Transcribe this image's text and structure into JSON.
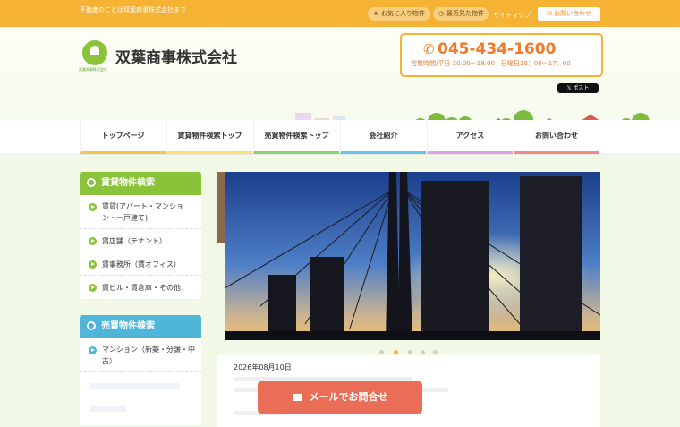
{
  "header": {
    "tagline": "不動産のことは双葉商事株式会社まで",
    "favorites": "お気に入り物件",
    "recent": "最近見た物件",
    "sitemap": "サイトマップ",
    "contact": "お問い合わせ",
    "company_name": "双葉商事株式会社",
    "logo_sub": "双葉商事株式会社",
    "phone": "045-434-1600",
    "hours": "営業時間/平日 10:00～18:00　日曜日10：00～17：00",
    "post": "ポスト"
  },
  "nav": [
    {
      "label": "トップページ",
      "color": "#f2c544"
    },
    {
      "label": "賃貸物件検索トップ",
      "color": "#f6e36a"
    },
    {
      "label": "売買物件検索トップ",
      "color": "#8fd16a"
    },
    {
      "label": "会社紹介",
      "color": "#65c7e6"
    },
    {
      "label": "アクセス",
      "color": "#d7a6e0"
    },
    {
      "label": "お問い合わせ",
      "color": "#f2897e"
    }
  ],
  "rental": {
    "title": "賃貸物件検索",
    "color": "#8ac23a",
    "items": [
      "賃貸(アパート・マンション・一戸建て)",
      "賃店舗（テナント）",
      "賃事務所（賃オフィス）",
      "賃ビル・賃倉庫・その他"
    ]
  },
  "sale": {
    "title": "売買物件検索",
    "color": "#4fb5da",
    "items": [
      "マンション（新築・分譲・中古）"
    ]
  },
  "news": {
    "date": "2026年08月10日"
  },
  "mail_button": "メールでお問合せ",
  "colors": {
    "accent": "#f6b233",
    "phone": "#f07a2a",
    "mail": "#ea6e57"
  }
}
